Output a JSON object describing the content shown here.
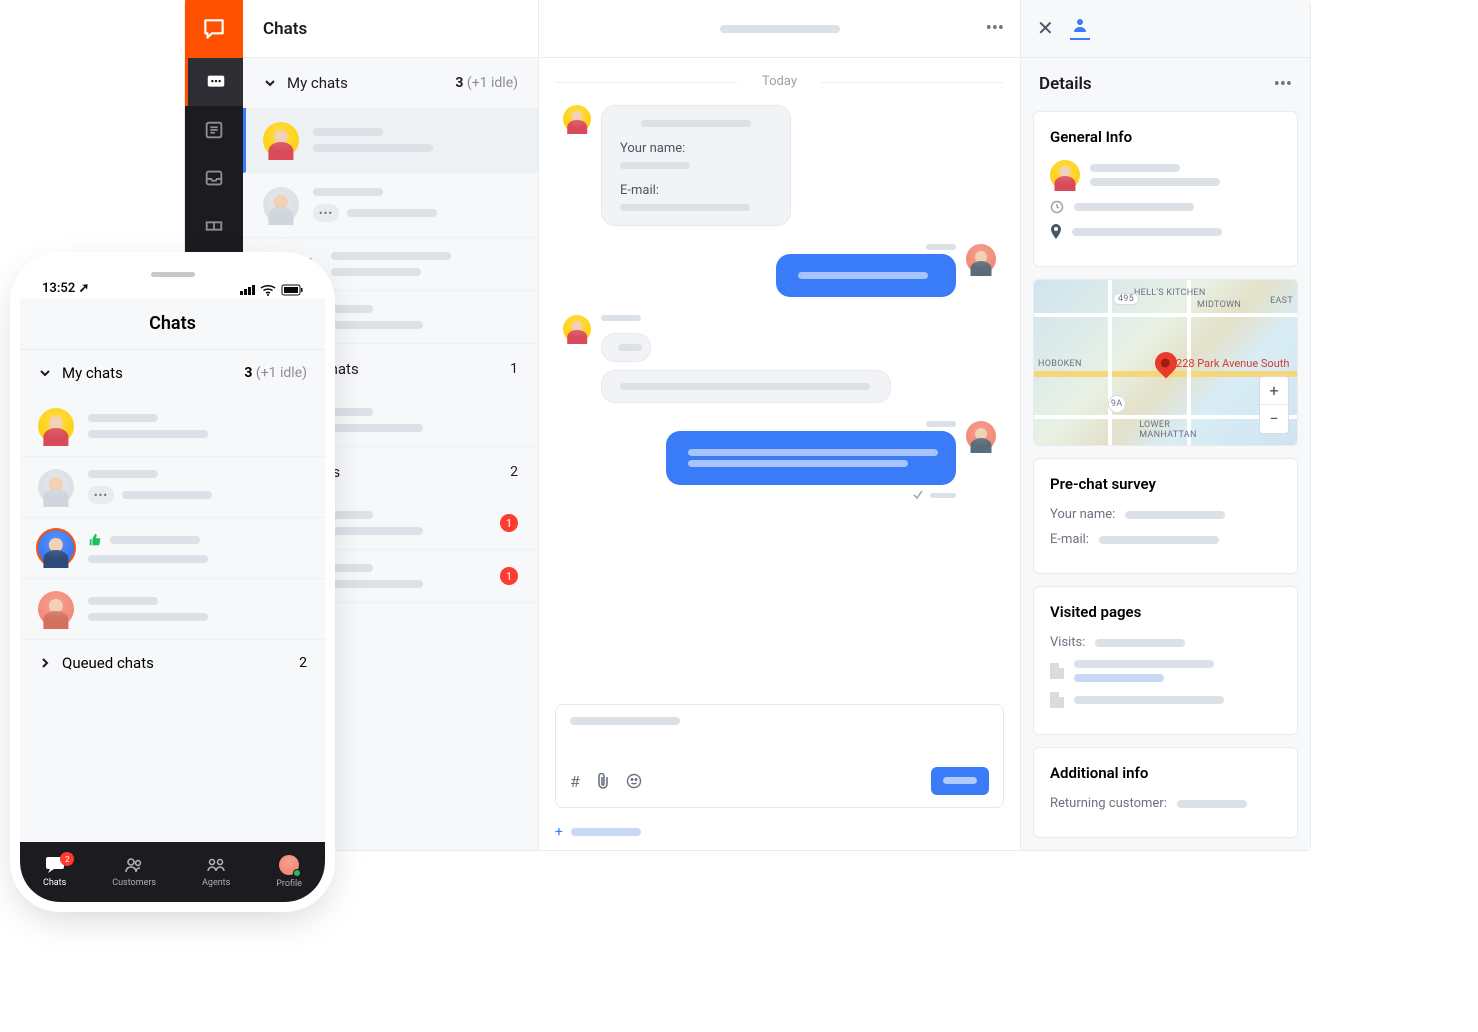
{
  "desktop": {
    "chats_title": "Chats",
    "sections": {
      "my_chats": {
        "label": "My chats",
        "count": "3",
        "idle": "(+1 idle)"
      },
      "supervised": {
        "label_partial": "vised chats",
        "count": "1"
      },
      "queued": {
        "label_partial": "ed chats",
        "count": "2"
      },
      "badge1": "1",
      "badge2": "1"
    },
    "conversation": {
      "date_label": "Today",
      "prechat": {
        "name_label": "Your name:",
        "email_label": "E-mail:"
      }
    },
    "details": {
      "header": "Details",
      "general_info": {
        "title": "General Info"
      },
      "map": {
        "pin_label": "228 Park Avenue South",
        "labels": {
          "hoboken": "Hoboken",
          "hells": "HELL'S KITCHEN",
          "midtown": "MIDTOWN",
          "east": "EAST",
          "i495": "495",
          "route9a": "9A",
          "lower": "LOWER\nMANHATTAN"
        },
        "zoom_in": "+",
        "zoom_out": "−"
      },
      "prechat": {
        "title": "Pre-chat survey",
        "name_label": "Your name:",
        "email_label": "E-mail:"
      },
      "visited": {
        "title": "Visited pages",
        "visits_label": "Visits:"
      },
      "additional": {
        "title": "Additional info",
        "returning_label": "Returning customer:"
      }
    }
  },
  "phone": {
    "time": "13:52",
    "title": "Chats",
    "my_chats": {
      "label": "My chats",
      "count": "3",
      "idle": "(+1 idle)"
    },
    "queued": {
      "label": "Queued chats",
      "count": "2"
    },
    "tabs": {
      "chats": "Chats",
      "customers": "Customers",
      "agents": "Agents",
      "profile": "Profile",
      "chats_badge": "2"
    }
  }
}
